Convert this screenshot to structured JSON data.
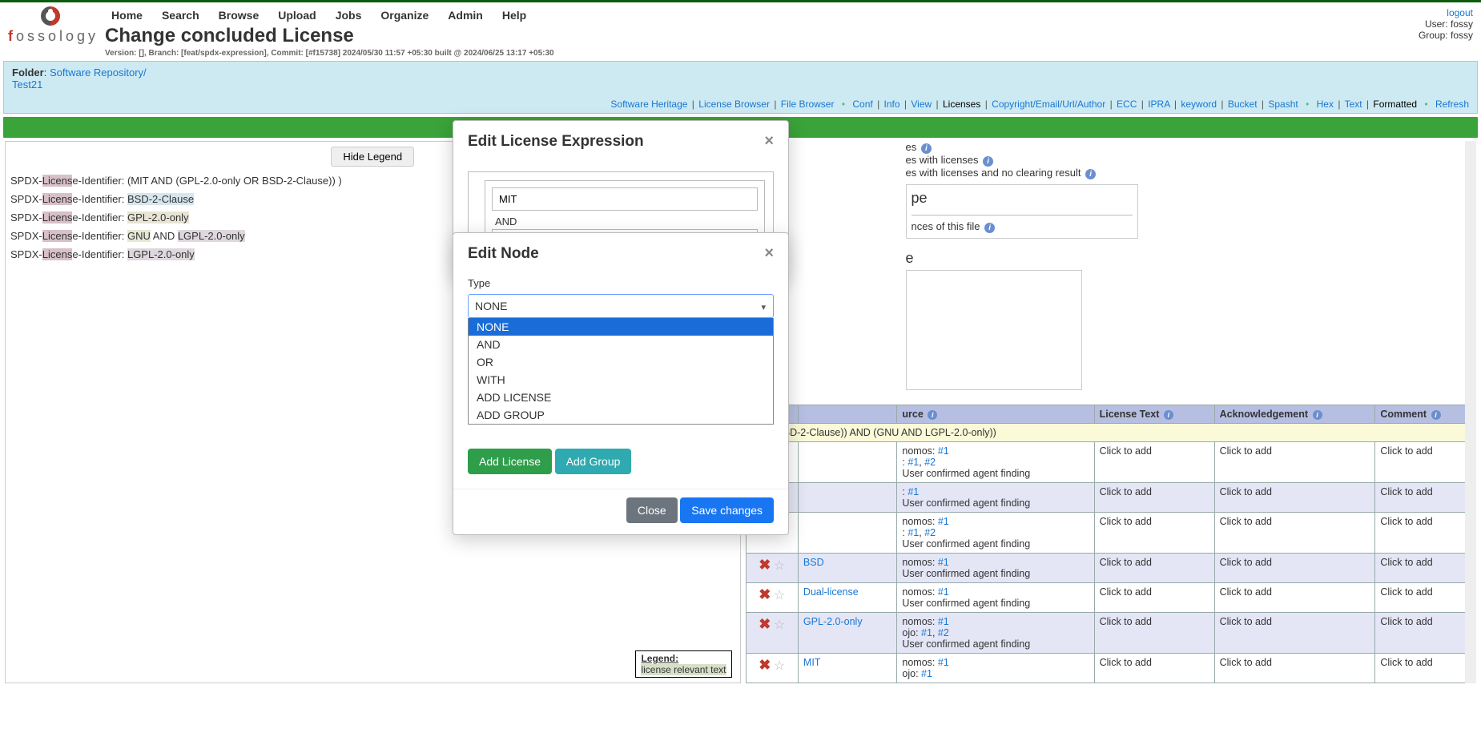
{
  "brand": {
    "text": "fossology"
  },
  "topnav": [
    "Home",
    "Search",
    "Browse",
    "Upload",
    "Jobs",
    "Organize",
    "Admin",
    "Help"
  ],
  "page_title": "Change concluded License",
  "version_line": "Version: [], Branch: [feat/spdx-expression], Commit: [#f15738] 2024/05/30 11:57 +05:30 built @ 2024/06/25 13:17 +05:30",
  "user_block": {
    "logout": "logout",
    "user_label": "User:",
    "user": "fossy",
    "group_label": "Group:",
    "group": "fossy"
  },
  "breadcrumb": {
    "folder_label": "Folder",
    "repo": "Software Repository/",
    "item": "Test21"
  },
  "subnav": {
    "left": [
      "Software Heritage",
      "License Browser",
      "File Browser"
    ],
    "mid": [
      "Conf",
      "Info",
      "View",
      "Licenses",
      "Copyright/Email/Url/Author",
      "ECC",
      "IPRA",
      "keyword",
      "Bucket",
      "Spasht"
    ],
    "active": "Licenses",
    "right": [
      "Hex",
      "Text",
      "Formatted"
    ],
    "right_active": "Formatted",
    "refresh": "Refresh"
  },
  "left_pane": {
    "hide_legend": "Hide Legend",
    "lines": [
      {
        "prefix": "SPDX-",
        "lic": "Licens",
        "rest": "e-Identifier: (MIT AND (GPL-2.0-only OR BSD-2-Clause)) )",
        "hl": ""
      },
      {
        "prefix": "SPDX-",
        "lic": "Licens",
        "rest": "e-Identifier: ",
        "tail": "BSD-2-Clause",
        "tailCls": "hl-bsd"
      },
      {
        "prefix": "SPDX-",
        "lic": "Licens",
        "rest": "e-Identifier: ",
        "tail": "GPL-2.0-only",
        "tailCls": "hl-gpl"
      },
      {
        "prefix": "SPDX-",
        "lic": "Licens",
        "rest": "e-Identifier: ",
        "mid": "GNU",
        "midCls": "hl-gnu",
        "conj": " AND ",
        "tail": "LGPL-2.0-only",
        "tailCls": "hl-lgpl"
      },
      {
        "prefix": "SPDX-",
        "lic": "Licens",
        "rest": "e-Identifier: ",
        "tail": "LGPL-2.0-only",
        "tailCls": "hl-lgpl"
      }
    ],
    "legend": {
      "title": "Legend:",
      "text": "license relevant text"
    }
  },
  "right_pane": {
    "lines": [
      "es",
      "es with licenses",
      "es with licenses and no clearing result"
    ],
    "box_title": "pe",
    "box_line": "nces of this file"
  },
  "modal_expr": {
    "title": "Edit License Expression",
    "node1": "MIT",
    "conj": "AND",
    "add_license": "Add License",
    "add_group": "Add Group",
    "close": "Close",
    "save": "Save changes"
  },
  "modal_node": {
    "title": "Edit Node",
    "type_label": "Type",
    "selected": "NONE",
    "options": [
      "NONE",
      "AND",
      "OR",
      "WITH",
      "ADD LICENSE",
      "ADD GROUP"
    ]
  },
  "table": {
    "headers": [
      "",
      "",
      "urce",
      "License Text",
      "Acknowledgement",
      "Comment"
    ],
    "expr_row": "y OR BSD-2-Clause)) AND (GNU AND LGPL-2.0-only))",
    "click": "Click to add",
    "user_conf": "User confirmed agent finding",
    "rows": [
      {
        "src": [
          [
            "nomos:",
            "#1"
          ],
          [
            ":",
            "#1",
            "#2"
          ]
        ],
        "alt": false
      },
      {
        "src": [
          [
            ":",
            "#1"
          ]
        ],
        "alt": true
      },
      {
        "src": [
          [
            "nomos:",
            "#1"
          ],
          [
            ":",
            "#1",
            "#2"
          ]
        ],
        "alt": false
      },
      {
        "lic": "BSD",
        "src": [
          [
            "nomos:",
            "#1"
          ]
        ],
        "alt": true
      },
      {
        "lic": "Dual-license",
        "src": [
          [
            "nomos:",
            "#1"
          ]
        ],
        "alt": false
      },
      {
        "lic": "GPL-2.0-only",
        "src": [
          [
            "nomos:",
            "#1"
          ],
          [
            "ojo:",
            "#1",
            "#2"
          ]
        ],
        "alt": true
      },
      {
        "lic": "MIT",
        "src": [
          [
            "nomos:",
            "#1"
          ],
          [
            "ojo:",
            "#1"
          ]
        ],
        "alt": false,
        "noconf": true
      }
    ]
  }
}
